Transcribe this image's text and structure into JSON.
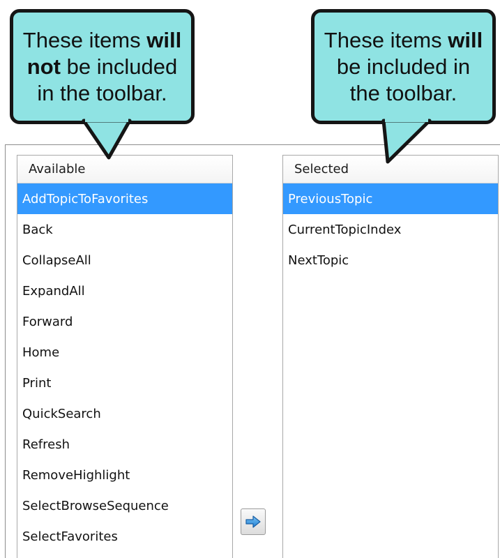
{
  "callouts": {
    "left": {
      "line1_pre": "These items ",
      "line1_bold": "will",
      "line2_bold": "not",
      "line2_post": " be included",
      "line3": "in the toolbar."
    },
    "right": {
      "line1_pre": "These items ",
      "line1_bold": "will",
      "line2": "be included in",
      "line3": "the toolbar."
    }
  },
  "available": {
    "header": "Available",
    "items": [
      "AddTopicToFavorites",
      "Back",
      "CollapseAll",
      "ExpandAll",
      "Forward",
      "Home",
      "Print",
      "QuickSearch",
      "Refresh",
      "RemoveHighlight",
      "SelectBrowseSequence",
      "SelectFavorites"
    ],
    "selected_item": "AddTopicToFavorites"
  },
  "selected": {
    "header": "Selected",
    "items": [
      "PreviousTopic",
      "CurrentTopicIndex",
      "NextTopic"
    ],
    "selected_item": "PreviousTopic"
  },
  "move_button": {
    "icon": "arrow-right-icon"
  },
  "colors": {
    "callout_fill": "#8fe3e3",
    "selection": "#3399ff",
    "arrow": "#3a8fd8"
  }
}
